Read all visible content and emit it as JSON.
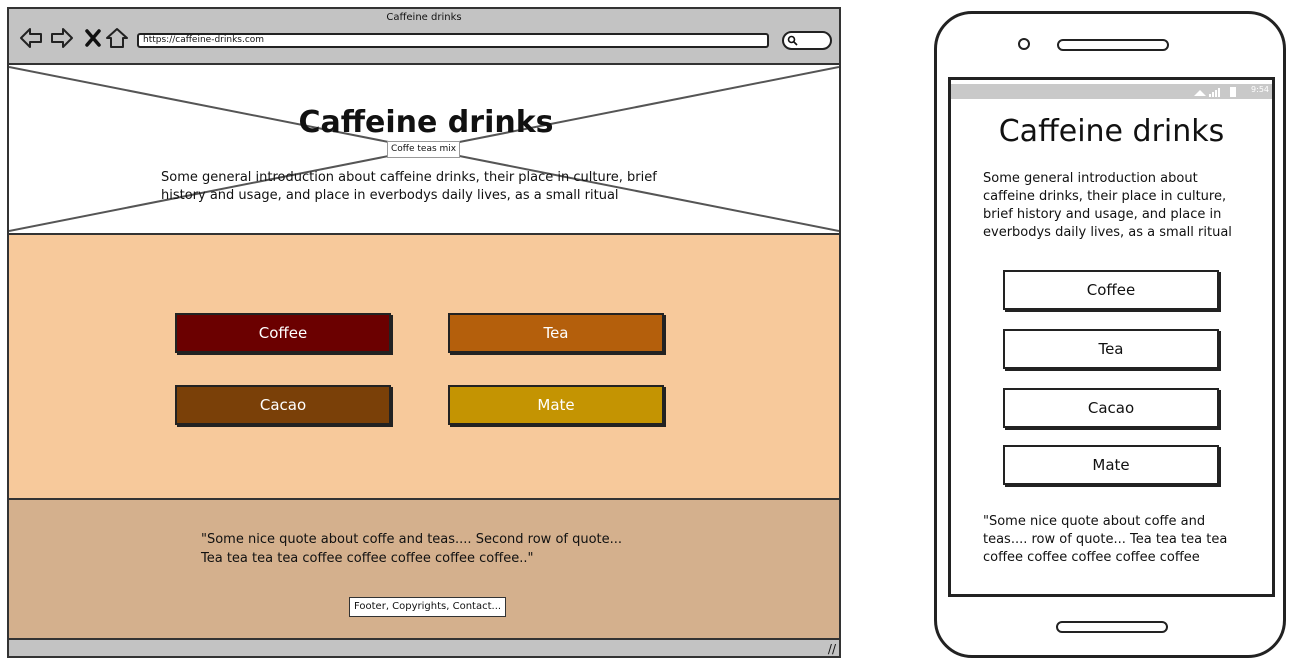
{
  "browser": {
    "window_title": "Caffeine drinks",
    "url": "https://caffeine-drinks.com",
    "nav_icons": [
      "back-arrow-icon",
      "forward-arrow-icon",
      "close-x-icon",
      "home-icon"
    ],
    "search_icon": "search-icon"
  },
  "hero": {
    "title": "Caffeine drinks",
    "image_label": "Coffe teas mix",
    "intro": "Some general introduction about caffeine drinks, their place in culture, brief history and usage, and place in everbodys daily lives, as a small ritual"
  },
  "drinks": [
    {
      "label": "Coffee",
      "color": "#6b0000"
    },
    {
      "label": "Tea",
      "color": "#b45f0c"
    },
    {
      "label": "Cacao",
      "color": "#7a4008"
    },
    {
      "label": "Mate",
      "color": "#c49402"
    }
  ],
  "colors": {
    "cards_bg": "#f7c99b",
    "footer_bg": "#d4b08d",
    "chrome": "#c3c3c3"
  },
  "footer": {
    "quote_line1": "\"Some nice quote about coffe and teas.... Second row of quote...",
    "quote_line2": "Tea tea tea tea coffee coffee coffee coffee coffee..\"",
    "link_label": "Footer, Copyrights, Contact..."
  },
  "phone": {
    "status_time": "9:54",
    "title": "Caffeine drinks",
    "intro": "Some general introduction about caffeine drinks, their place in culture, brief history and usage, and place in everbodys daily lives, as a small ritual",
    "buttons": [
      "Coffee",
      "Tea",
      "Cacao",
      "Mate"
    ],
    "quote": "\"Some nice quote about coffe and teas.... row of quote... Tea tea tea tea coffee coffee coffee coffee coffee"
  }
}
